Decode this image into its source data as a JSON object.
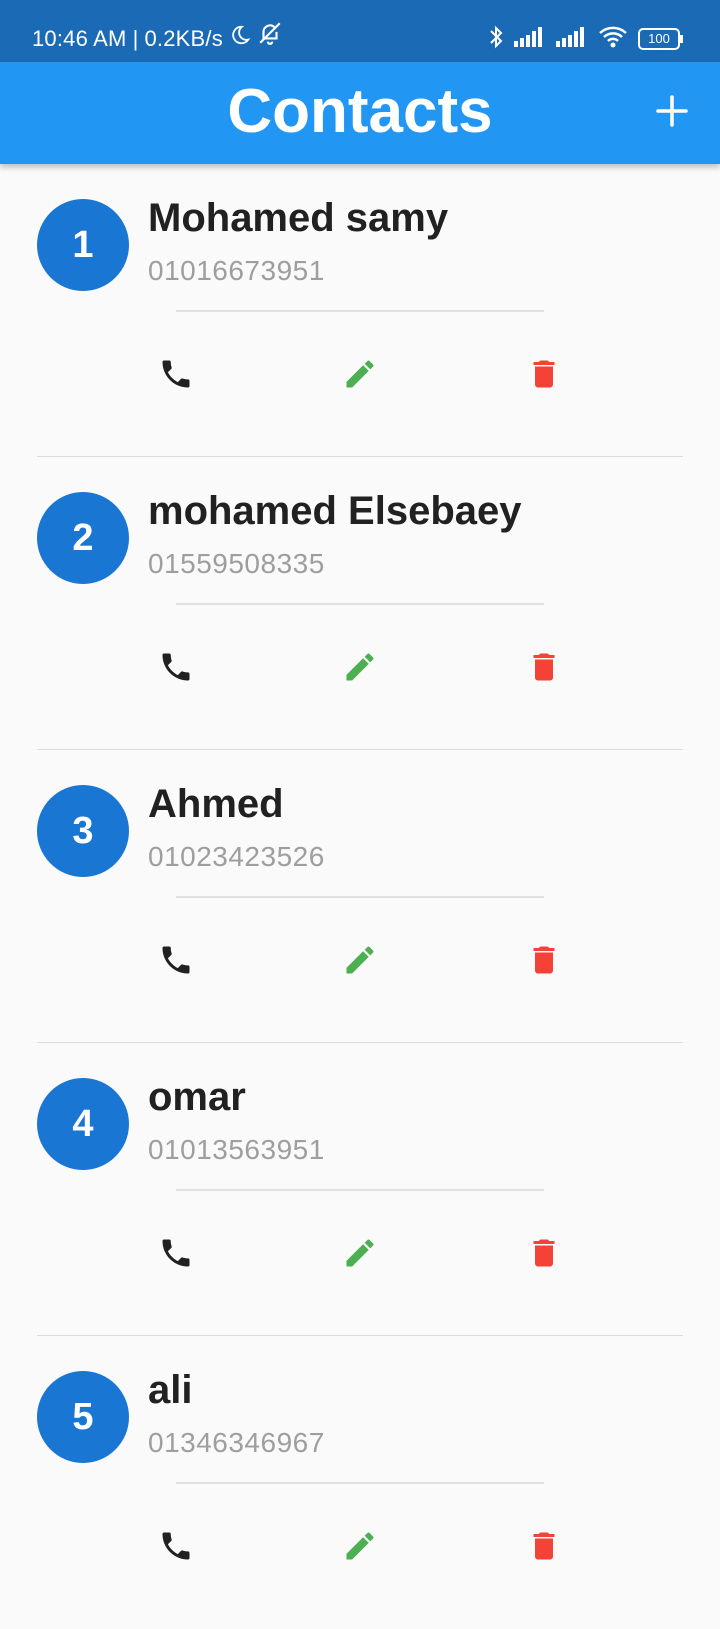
{
  "status_bar": {
    "time": "10:46 AM",
    "network_speed": "0.2KB/s",
    "battery": "100",
    "icons": [
      "moon-icon",
      "bell-off-icon",
      "bluetooth-icon",
      "signal-icon",
      "signal-icon",
      "wifi-icon",
      "battery-icon"
    ]
  },
  "app_bar": {
    "title": "Contacts",
    "add_icon": "plus-icon"
  },
  "colors": {
    "status_bar": "#1b6ab5",
    "app_bar": "#2196f3",
    "avatar": "#1976d2",
    "call_icon": "#212121",
    "edit_icon": "#4caf50",
    "delete_icon": "#f44336"
  },
  "contacts": [
    {
      "index": "1",
      "name": "Mohamed samy",
      "phone": "01016673951"
    },
    {
      "index": "2",
      "name": "mohamed Elsebaey",
      "phone": "01559508335"
    },
    {
      "index": "3",
      "name": "Ahmed",
      "phone": "01023423526"
    },
    {
      "index": "4",
      "name": "omar",
      "phone": "01013563951"
    },
    {
      "index": "5",
      "name": "ali",
      "phone": "01346346967"
    }
  ],
  "actions": [
    "phone-icon",
    "edit-icon",
    "delete-icon"
  ]
}
